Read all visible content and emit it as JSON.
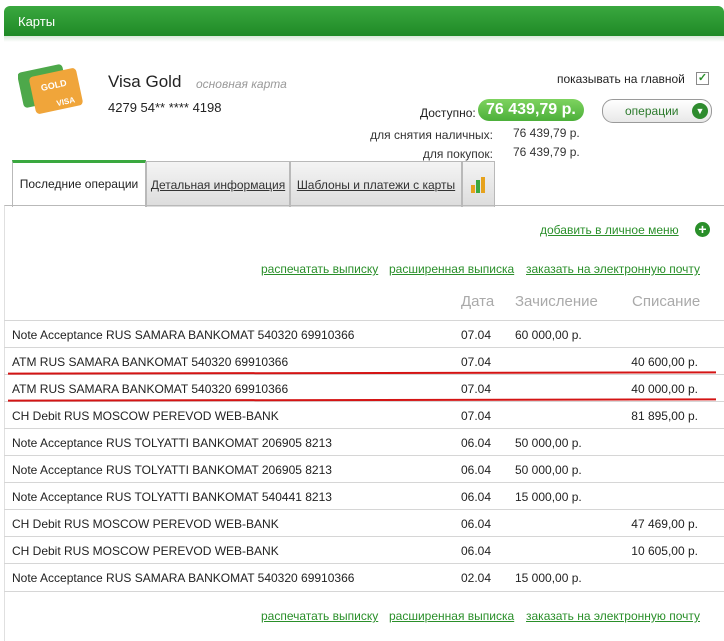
{
  "header": {
    "title": "Карты"
  },
  "card": {
    "name": "Visa Gold",
    "subtitle": "основная карта",
    "number": "4279 54** **** 4198",
    "icon": "gold-visa-card-icon",
    "icon_text_top": "GOLD",
    "icon_text_bottom": "VISA"
  },
  "show_on_main": {
    "label": "показывать на главной",
    "checked": true,
    "mark": "✓"
  },
  "available": {
    "label": "Доступно:",
    "value": "76 439,79 р."
  },
  "operations_button": {
    "label": "операции",
    "chevron": "▼"
  },
  "limits": [
    {
      "label": "для снятия наличных:",
      "value": "76 439,79 р."
    },
    {
      "label": "для покупок:",
      "value": "76 439,79 р."
    }
  ],
  "tabs": [
    {
      "label": "Последние операции",
      "active": true
    },
    {
      "label": "Детальная информация",
      "active": false
    },
    {
      "label": "Шаблоны и платежи с карты",
      "active": false
    },
    {
      "label": "",
      "icon": "chart-icon",
      "active": false
    }
  ],
  "add_to_menu": {
    "label": "добавить в личное меню",
    "icon": "plus-icon"
  },
  "actions": {
    "print": "распечатать выписку",
    "extended": "расширенная выписка",
    "order": "заказать на электронную почту"
  },
  "table": {
    "headers": {
      "date": "Дата",
      "credit": "Зачисление",
      "debit": "Списание"
    },
    "rows": [
      {
        "desc": "Note Acceptance RUS SAMARA BANKOMAT 540320 69910366",
        "date": "07.04",
        "credit": "60 000,00 р.",
        "debit": ""
      },
      {
        "desc": "ATM RUS SAMARA BANKOMAT 540320 69910366",
        "date": "07.04",
        "credit": "",
        "debit": "40 600,00 р.",
        "underlined": true
      },
      {
        "desc": "ATM RUS SAMARA BANKOMAT 540320 69910366",
        "date": "07.04",
        "credit": "",
        "debit": "40 000,00 р.",
        "underlined": true
      },
      {
        "desc": "CH Debit RUS MOSCOW PEREVOD WEB-BANK",
        "date": "07.04",
        "credit": "",
        "debit": "81 895,00 р."
      },
      {
        "desc": "Note Acceptance RUS TOLYATTI BANKOMAT 206905 8213",
        "date": "06.04",
        "credit": "50 000,00 р.",
        "debit": ""
      },
      {
        "desc": "Note Acceptance RUS TOLYATTI BANKOMAT 206905 8213",
        "date": "06.04",
        "credit": "50 000,00 р.",
        "debit": ""
      },
      {
        "desc": "Note Acceptance RUS TOLYATTI BANKOMAT 540441 8213",
        "date": "06.04",
        "credit": "15 000,00 р.",
        "debit": ""
      },
      {
        "desc": "CH Debit RUS MOSCOW PEREVOD WEB-BANK",
        "date": "06.04",
        "credit": "",
        "debit": "47 469,00 р."
      },
      {
        "desc": "CH Debit RUS MOSCOW PEREVOD WEB-BANK",
        "date": "06.04",
        "credit": "",
        "debit": "10 605,00 р."
      },
      {
        "desc": "Note Acceptance RUS SAMARA BANKOMAT 540320 69910366",
        "date": "02.04",
        "credit": "15 000,00 р.",
        "debit": ""
      }
    ]
  },
  "colors": {
    "brand_green": "#1f8a26",
    "link_green": "#2a8f2a",
    "highlight_red": "#d41414"
  }
}
